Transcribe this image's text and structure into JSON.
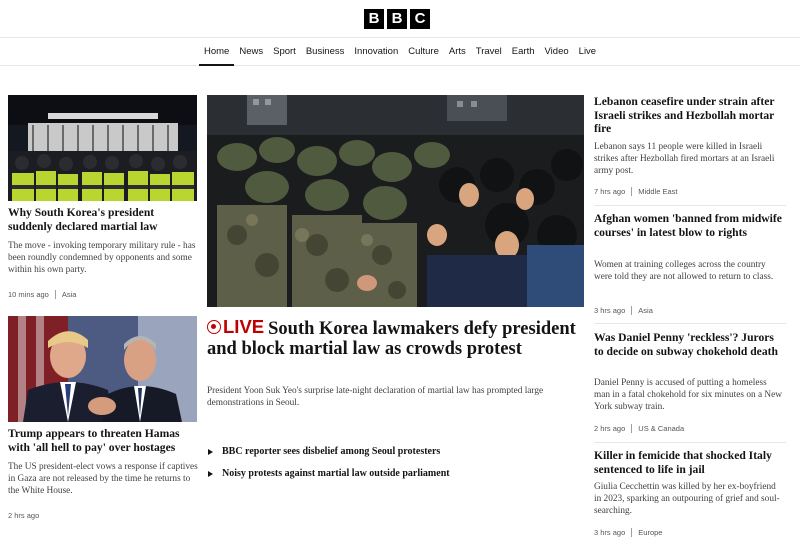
{
  "logo": {
    "letters": [
      "B",
      "B",
      "C"
    ]
  },
  "nav": {
    "items": [
      "Home",
      "News",
      "Sport",
      "Business",
      "Innovation",
      "Culture",
      "Arts",
      "Travel",
      "Earth",
      "Video",
      "Live"
    ],
    "active": "Home"
  },
  "left": [
    {
      "headline": "Why South Korea's president suddenly declared martial law",
      "summary": "The move - invoking temporary military rule - has been roundly condemned by opponents and some within his own party.",
      "time": "10 mins ago",
      "tag": "Asia"
    },
    {
      "headline": "Trump appears to threaten Hamas with 'all hell to pay' over hostages",
      "summary": "The US president-elect vows a response if captives in Gaza are not released by the time he returns to the White House.",
      "time": "2 hrs ago",
      "tag": ""
    }
  ],
  "main": {
    "live_label": "LIVE",
    "headline": "South Korea lawmakers defy president and block martial law as crowds protest",
    "summary": "President Yoon Suk Yeo's surprise late-night declaration of martial law has prompted large demonstrations in Seoul.",
    "related": [
      "BBC reporter sees disbelief among Seoul protesters",
      "Noisy protests against martial law outside parliament"
    ]
  },
  "right": [
    {
      "headline": "Lebanon ceasefire under strain after Israeli strikes and Hezbollah mortar fire",
      "summary": "Lebanon says 11 people were killed in Israeli strikes after Hezbollah fired mortars at an Israeli army post.",
      "time": "7 hrs ago",
      "tag": "Middle East"
    },
    {
      "headline": "Afghan women 'banned from midwife courses' in latest blow to rights",
      "summary": "Women at training colleges across the country were told they are not allowed to return to class.",
      "time": "3 hrs ago",
      "tag": "Asia"
    },
    {
      "headline": "Was Daniel Penny 'reckless'? Jurors to decide on subway chokehold death",
      "summary": "Daniel Penny is accused of putting a homeless man in a fatal chokehold for six minutes on a New York subway train.",
      "time": "2 hrs ago",
      "tag": "US & Canada"
    },
    {
      "headline": "Killer in femicide that shocked Italy sentenced to life in jail",
      "summary": "Giulia Cecchettin was killed by her ex-boyfriend in 2023, sparking an outpouring of grief and soul-searching.",
      "time": "3 hrs ago",
      "tag": "Europe"
    }
  ]
}
